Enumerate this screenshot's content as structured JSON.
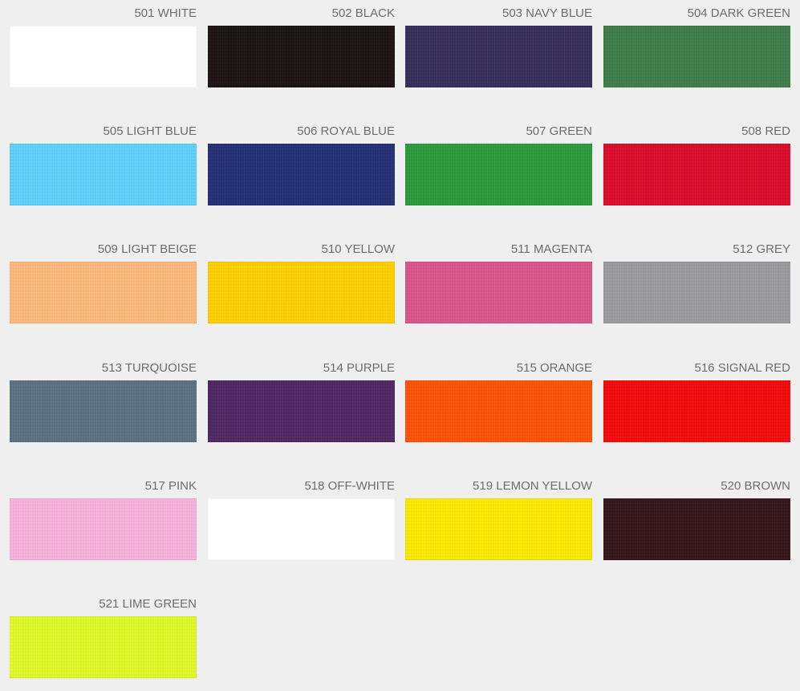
{
  "swatches": [
    {
      "code": "501",
      "label": "501 WHITE",
      "color": "#ffffff"
    },
    {
      "code": "502",
      "label": "502 BLACK",
      "color": "#1b1113"
    },
    {
      "code": "503",
      "label": "503 NAVY BLUE",
      "color": "#352d5a"
    },
    {
      "code": "504",
      "label": "504 DARK GREEN",
      "color": "#3d7b49"
    },
    {
      "code": "505",
      "label": "505 LIGHT BLUE",
      "color": "#5fd1fb"
    },
    {
      "code": "506",
      "label": "506 ROYAL BLUE",
      "color": "#242f75"
    },
    {
      "code": "507",
      "label": "507 GREEN",
      "color": "#2c9a3d"
    },
    {
      "code": "508",
      "label": "508 RED",
      "color": "#db0a2b"
    },
    {
      "code": "509",
      "label": "509 LIGHT BEIGE",
      "color": "#ffb97c"
    },
    {
      "code": "510",
      "label": "510 YELLOW",
      "color": "#ffd000"
    },
    {
      "code": "511",
      "label": "511 MAGENTA",
      "color": "#d9558a"
    },
    {
      "code": "512",
      "label": "512 GREY",
      "color": "#9b9a9f"
    },
    {
      "code": "513",
      "label": "513 TURQUOISE",
      "color": "#5d7182"
    },
    {
      "code": "514",
      "label": "514 PURPLE",
      "color": "#4e2762"
    },
    {
      "code": "515",
      "label": "515 ORANGE",
      "color": "#ff5206"
    },
    {
      "code": "516",
      "label": "516 SIGNAL RED",
      "color": "#f40a0a"
    },
    {
      "code": "517",
      "label": "517 PINK",
      "color": "#f9b3db"
    },
    {
      "code": "518",
      "label": "518 OFF-WHITE",
      "color": "#ffffff"
    },
    {
      "code": "519",
      "label": "519 LEMON YELLOW",
      "color": "#fdea00"
    },
    {
      "code": "520",
      "label": "520 BROWN",
      "color": "#34141a"
    },
    {
      "code": "521",
      "label": "521 LIME GREEN",
      "color": "#e1fb28"
    }
  ]
}
